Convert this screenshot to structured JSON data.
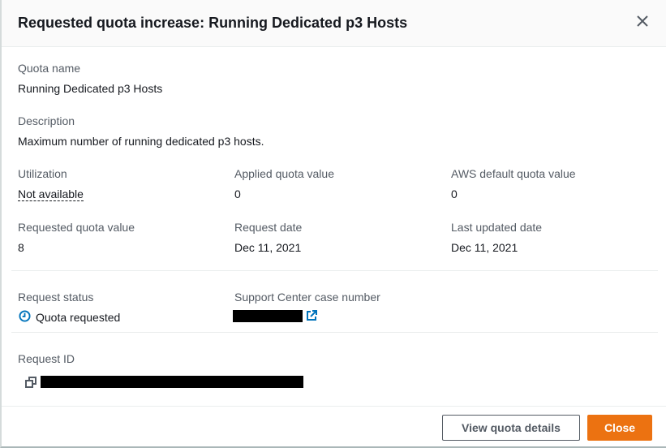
{
  "header": {
    "title": "Requested quota increase: Running Dedicated p3 Hosts"
  },
  "quota_name": {
    "label": "Quota name",
    "value": "Running Dedicated p3 Hosts"
  },
  "description": {
    "label": "Description",
    "value": "Maximum number of running dedicated p3 hosts."
  },
  "utilization": {
    "label": "Utilization",
    "value": "Not available"
  },
  "applied": {
    "label": "Applied quota value",
    "value": "0"
  },
  "default": {
    "label": "AWS default quota value",
    "value": "0"
  },
  "requested": {
    "label": "Requested quota value",
    "value": "8"
  },
  "request_date": {
    "label": "Request date",
    "value": "Dec 11, 2021"
  },
  "last_updated": {
    "label": "Last updated date",
    "value": "Dec 11, 2021"
  },
  "status": {
    "label": "Request status",
    "value": "Quota requested",
    "color": "#0073bb"
  },
  "case": {
    "label": "Support Center case number"
  },
  "request_id": {
    "label": "Request ID"
  },
  "footer": {
    "view_label": "View quota details",
    "close_label": "Close",
    "accent": "#ec7211"
  }
}
